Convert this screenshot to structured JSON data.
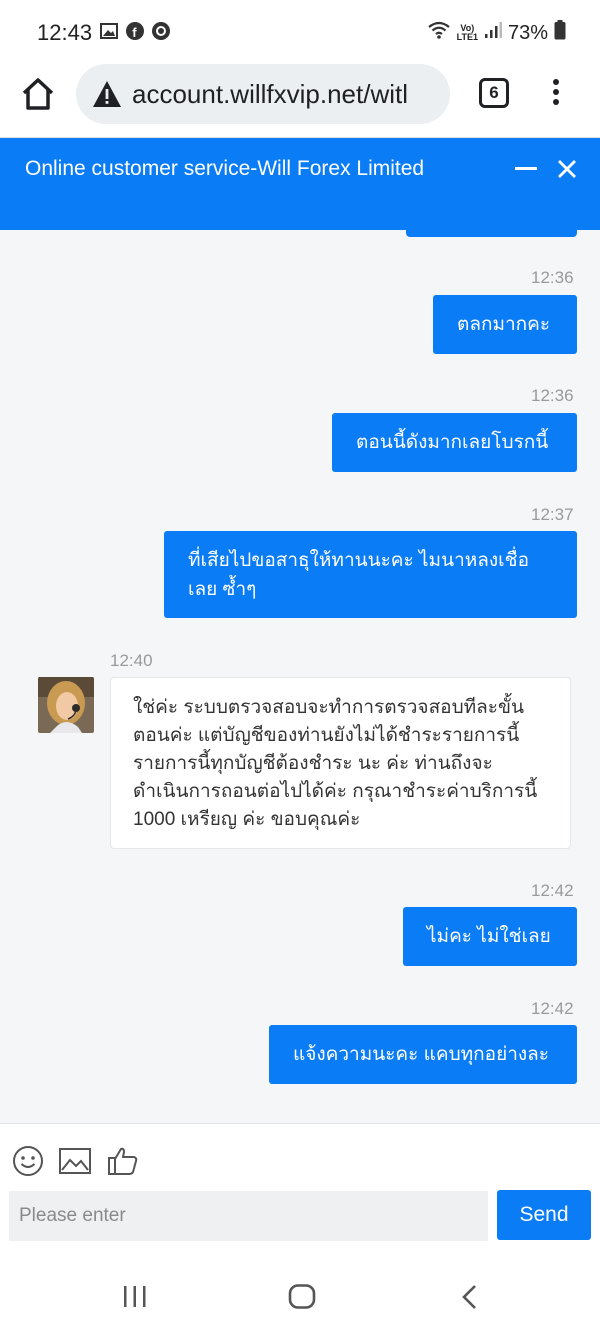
{
  "status": {
    "time": "12:43",
    "battery": "73%",
    "network_label_top": "Vo)",
    "network_label_bottom": "LTE1"
  },
  "browser": {
    "url": "account.willfxvip.net/witl",
    "tab_count": "6"
  },
  "chat": {
    "title": "Online customer service-Will Forex Limited",
    "messages": [
      {
        "time": "12:36",
        "text": "ตลกมากคะ"
      },
      {
        "time": "12:36",
        "text": "ตอนนี้ดังมากเลยโบรกนี้"
      },
      {
        "time": "12:37",
        "text": "ที่เสียไปขอสาธุให้ทานนะคะ ไมนาหลงเชื่อ เลย ซ้ำๆ"
      },
      {
        "time": "12:40",
        "text": "ใช่ค่ะ ระบบตรวจสอบจะทำการตรวจสอบทีละขั้นตอนค่ะ แต่บัญชีของท่านยังไม่ได้ชำระรายการนี้ รายการนี้ทุกบัญชีต้องชำระ นะ ค่ะ ท่านถึงจะดำเนินการถอนต่อไปได้ค่ะ กรุณาชำระค่าบริการนี้ 1000 เหรียญ ค่ะ ขอบคุณค่ะ"
      },
      {
        "time": "12:42",
        "text": "ไม่คะ ไม่ใช่เลย"
      },
      {
        "time": "12:42",
        "text": "แจ้งความนะคะ แคบทุกอย่างละ"
      }
    ]
  },
  "composer": {
    "placeholder": "Please enter",
    "send_label": "Send"
  },
  "colors": {
    "accent": "#0a7cf5"
  }
}
